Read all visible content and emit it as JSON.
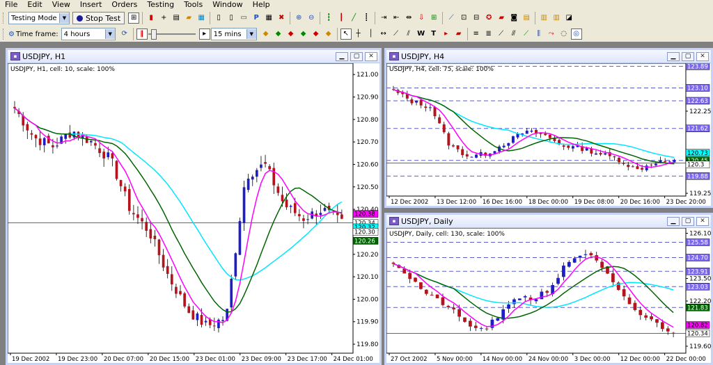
{
  "menu": [
    "File",
    "Edit",
    "View",
    "Insert",
    "Orders",
    "Testing",
    "Tools",
    "Window",
    "Help"
  ],
  "toolbar": {
    "mode_value": "Testing Mode",
    "stop_test_label": "Stop Test",
    "timeframe_label": "Time frame:",
    "timeframe_value": "4 hours",
    "speed_value": "15 mins",
    "text_tool": "T",
    "w_tool": "W"
  },
  "windows": [
    {
      "id": "h1",
      "title": "USDJPY, H1",
      "info": "USDJPY, H1, cell: 10, scale: 100%",
      "price_levels": [
        "121.00",
        "120.90",
        "120.80",
        "120.70",
        "120.60",
        "120.50",
        "120.40",
        "120.30",
        "120.20",
        "120.10",
        "120.00",
        "119.90",
        "119.80"
      ],
      "price_range": [
        119.76,
        121.05
      ],
      "badges": [
        {
          "value": "120.38",
          "color": "#ff00ff"
        },
        {
          "value": "120.34",
          "color": "#ffffff"
        },
        {
          "value": "120.32",
          "color": "#00ffff"
        },
        {
          "value": "120.30",
          "color": "#ffffff"
        },
        {
          "value": "120.26",
          "color": "#006400"
        }
      ],
      "dates": [
        "19 Dec 2002",
        "19 Dec 23:00",
        "20 Dec 07:00",
        "20 Dec 15:00",
        "23 Dec 01:00",
        "23 Dec 09:00",
        "23 Dec 17:00",
        "24 Dec 01:00"
      ],
      "hline": 120.34,
      "dashed_levels": []
    },
    {
      "id": "h4",
      "title": "USDJPY, H4",
      "info": "USDJPY, H4, cell: 75, scale: 100%",
      "price_levels": [
        "122.25",
        "119.25"
      ],
      "price_range": [
        119.15,
        124.0
      ],
      "badges": [
        {
          "value": "123.89",
          "color": "#7b68ee"
        },
        {
          "value": "123.10",
          "color": "#7b68ee"
        },
        {
          "value": "122.63",
          "color": "#7b68ee"
        },
        {
          "value": "121.62",
          "color": "#7b68ee"
        },
        {
          "value": "120.73",
          "color": "#00ffff"
        },
        {
          "value": "120.45",
          "color": "#006400"
        },
        {
          "value": "120.3",
          "color": "#ffffff"
        },
        {
          "value": "119.88",
          "color": "#7b68ee"
        }
      ],
      "dates": [
        "12 Dec 2002",
        "13 Dec 12:00",
        "16 Dec 16:00",
        "18 Dec 00:00",
        "19 Dec 08:00",
        "20 Dec 16:00",
        "23 Dec 20:00"
      ],
      "hline": 120.36,
      "dashed_levels": [
        123.89,
        123.1,
        122.63,
        121.62,
        120.45,
        119.88
      ]
    },
    {
      "id": "d1",
      "title": "USDJPY, Daily",
      "info": "USDJPY, Daily, cell: 130, scale: 100%",
      "price_levels": [
        "126.10",
        "123.50",
        "122.20",
        "119.60"
      ],
      "price_range": [
        119.2,
        126.4
      ],
      "badges": [
        {
          "value": "125.58",
          "color": "#7b68ee"
        },
        {
          "value": "124.70",
          "color": "#7b68ee"
        },
        {
          "value": "123.91",
          "color": "#7b68ee"
        },
        {
          "value": "123.03",
          "color": "#7b68ee"
        },
        {
          "value": "121.83",
          "color": "#006400"
        },
        {
          "value": "120.82",
          "color": "#ff00ff"
        },
        {
          "value": "120.34",
          "color": "#ffffff"
        }
      ],
      "dates": [
        "27 Oct 2002",
        "5 Nov 00:00",
        "14 Nov 00:00",
        "24 Nov 00:00",
        "3 Dec 00:00",
        "12 Dec 00:00",
        "22 Dec 00:00"
      ],
      "hline": 120.34,
      "dashed_levels": [
        125.58,
        124.7,
        123.91,
        123.03,
        121.83
      ]
    }
  ],
  "colors": {
    "up_candle": "#1e1ec8",
    "down_candle": "#b4141e",
    "ma_fast": "#ff00ff",
    "ma_mid": "#006400",
    "ma_slow": "#00e6ff",
    "dashed_level": "#5a5acd"
  }
}
